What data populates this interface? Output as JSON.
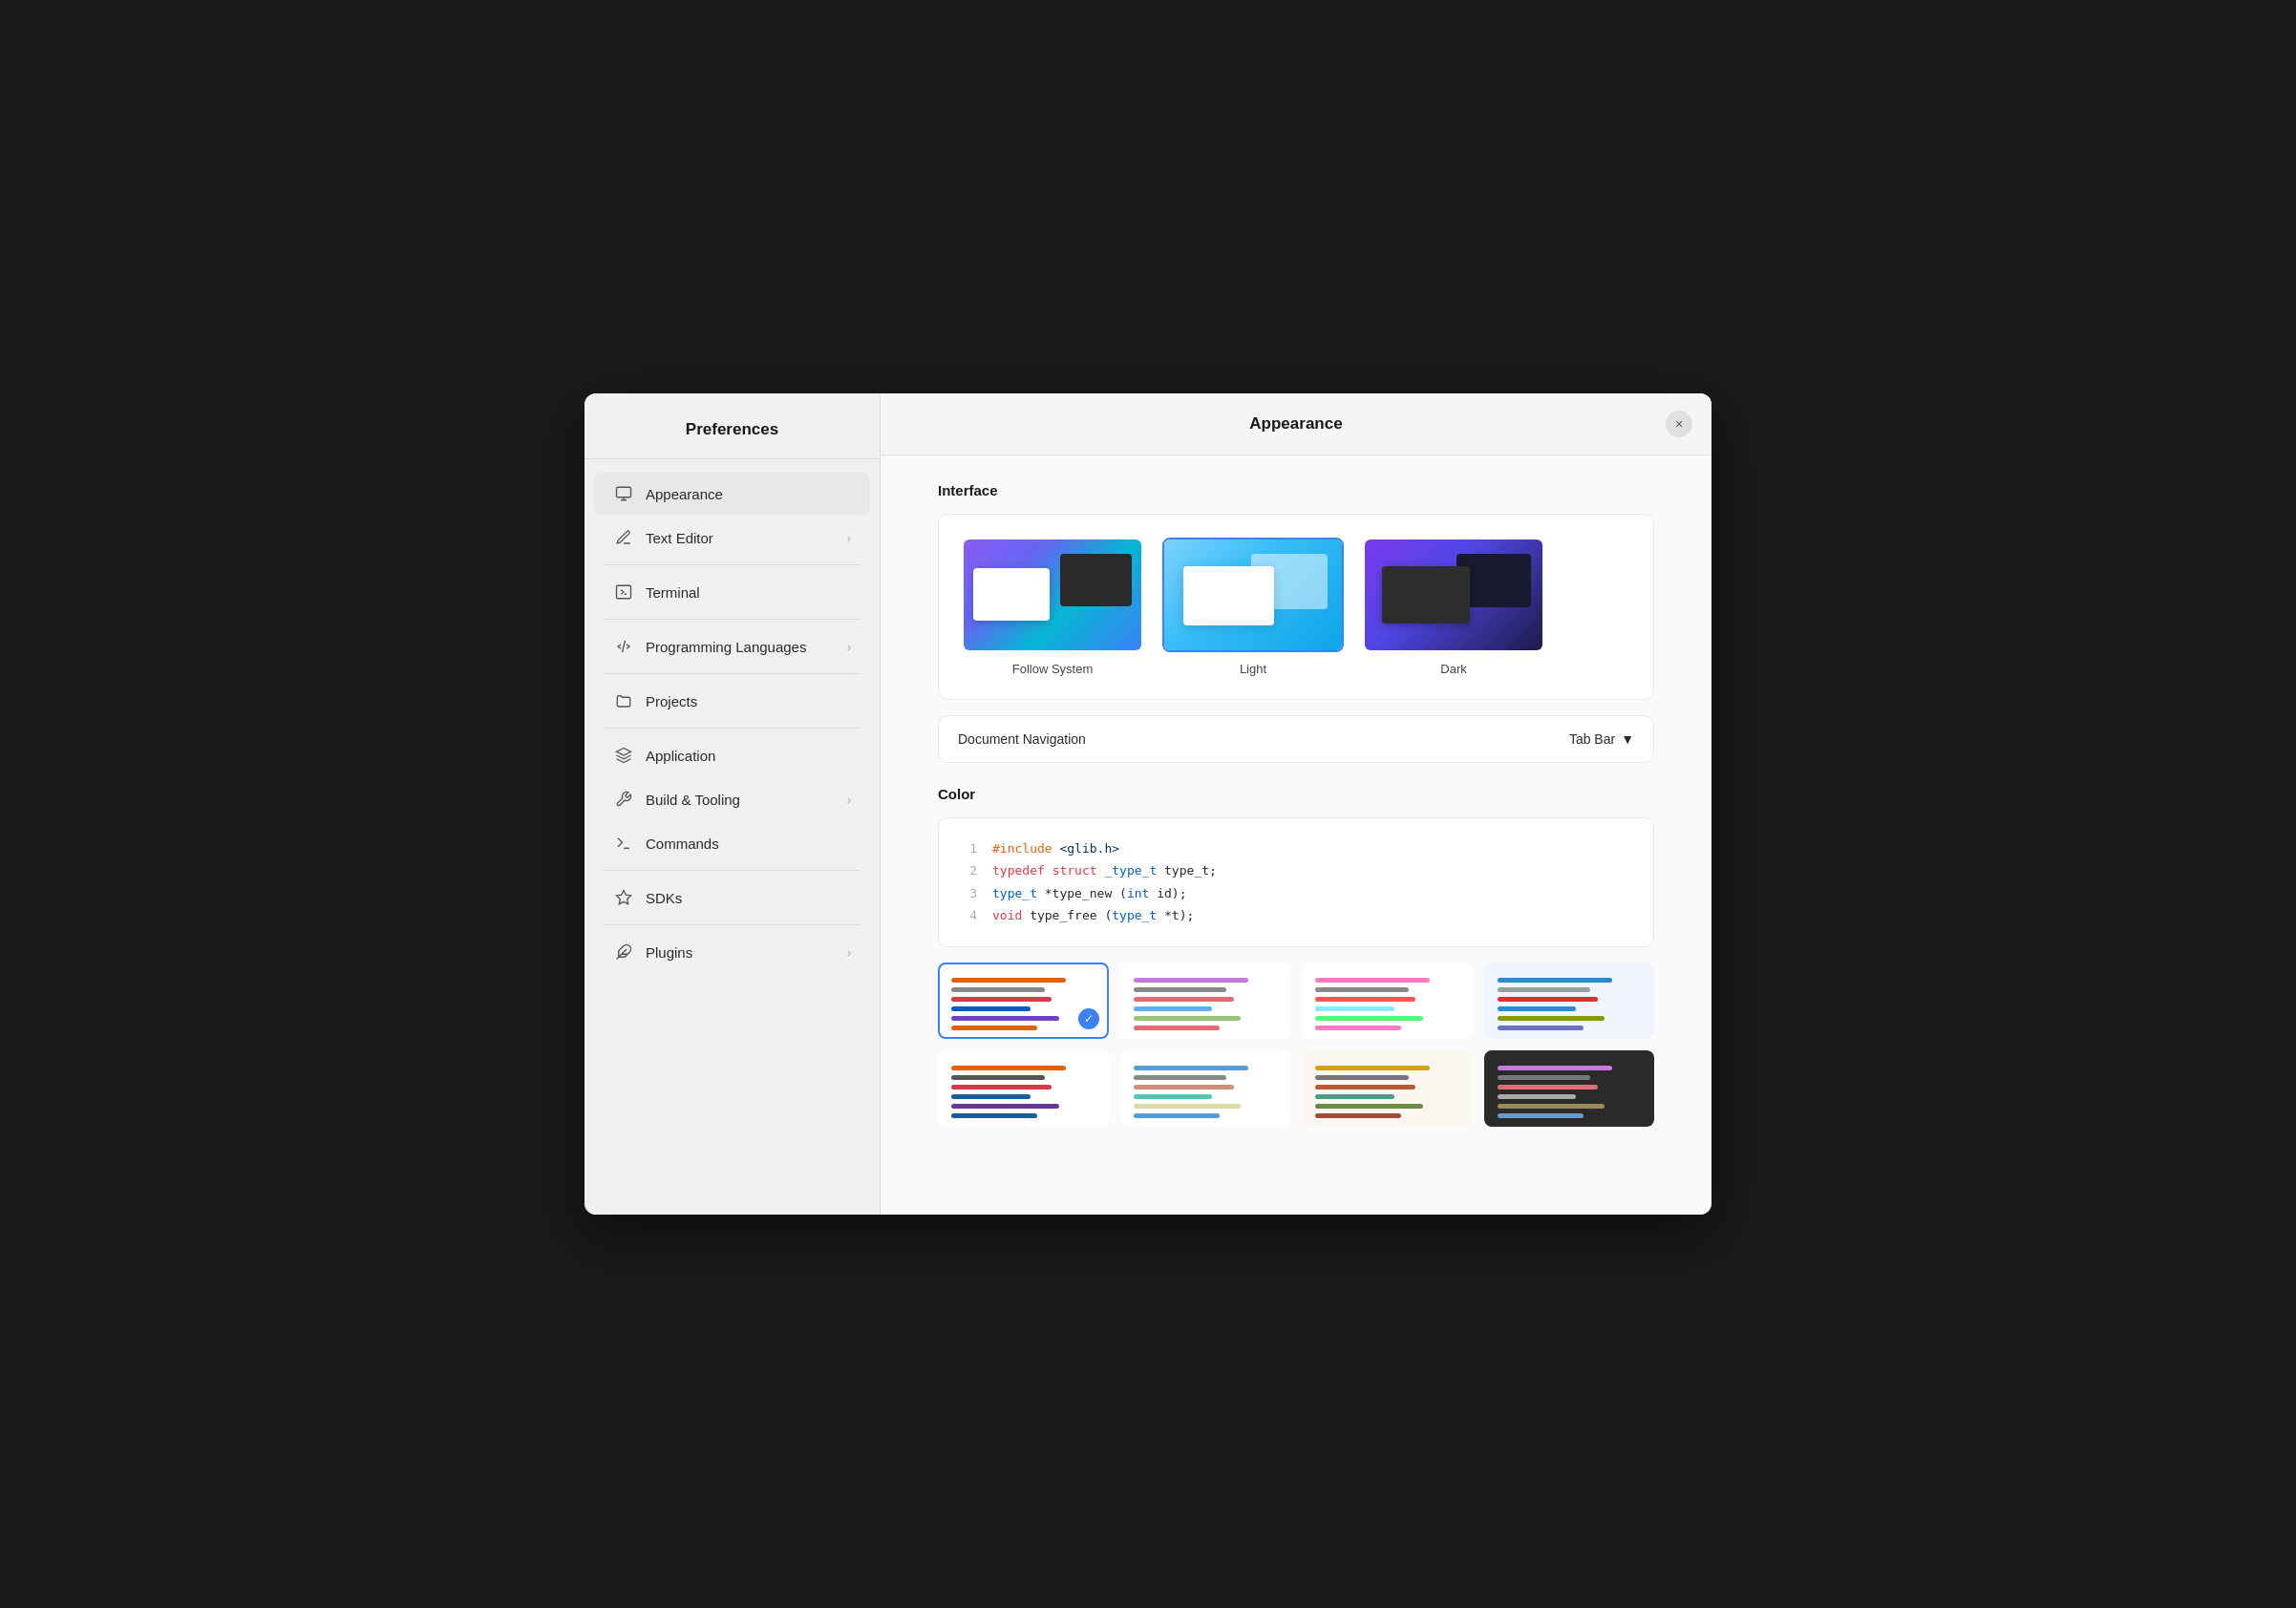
{
  "dialog": {
    "sidebar_title": "Preferences",
    "main_title": "Appearance",
    "close_label": "×"
  },
  "sidebar": {
    "items": [
      {
        "id": "appearance",
        "label": "Appearance",
        "icon": "appearance-icon",
        "active": true,
        "chevron": false
      },
      {
        "id": "text-editor",
        "label": "Text Editor",
        "icon": "text-editor-icon",
        "active": false,
        "chevron": true
      },
      {
        "id": "terminal",
        "label": "Terminal",
        "icon": "terminal-icon",
        "active": false,
        "chevron": false
      },
      {
        "id": "programming-languages",
        "label": "Programming Languages",
        "icon": "code-icon",
        "active": false,
        "chevron": true
      },
      {
        "id": "projects",
        "label": "Projects",
        "icon": "projects-icon",
        "active": false,
        "chevron": false
      },
      {
        "id": "application",
        "label": "Application",
        "icon": "application-icon",
        "active": false,
        "chevron": false
      },
      {
        "id": "build-tooling",
        "label": "Build & Tooling",
        "icon": "build-icon",
        "active": false,
        "chevron": true
      },
      {
        "id": "commands",
        "label": "Commands",
        "icon": "commands-icon",
        "active": false,
        "chevron": false
      },
      {
        "id": "sdks",
        "label": "SDKs",
        "icon": "sdks-icon",
        "active": false,
        "chevron": false
      },
      {
        "id": "plugins",
        "label": "Plugins",
        "icon": "plugins-icon",
        "active": false,
        "chevron": true
      }
    ]
  },
  "appearance": {
    "interface_section": "Interface",
    "themes": [
      {
        "id": "follow-system",
        "label": "Follow System",
        "selected": false
      },
      {
        "id": "light",
        "label": "Light",
        "selected": true
      },
      {
        "id": "dark",
        "label": "Dark",
        "selected": false
      }
    ],
    "document_navigation_label": "Document Navigation",
    "document_navigation_value": "Tab Bar",
    "color_section": "Color",
    "code_lines": [
      {
        "num": "1",
        "content": "#include <glib.h>"
      },
      {
        "num": "2",
        "content": "typedef struct _type_t type_t;"
      },
      {
        "num": "3",
        "content": "type_t *type_new (int id);"
      },
      {
        "num": "4",
        "content": "void type_free (type_t *t);"
      }
    ]
  }
}
